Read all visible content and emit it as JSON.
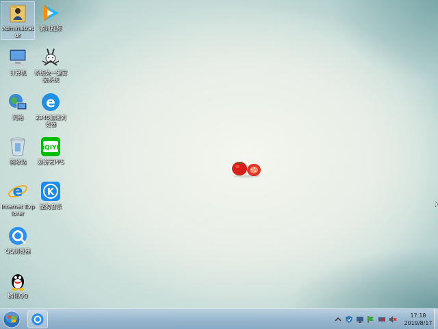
{
  "desktop_icons": [
    {
      "label": "Administrator",
      "icon": "user-folder-icon"
    },
    {
      "label": "腾讯视频",
      "icon": "tencent-video-icon"
    },
    {
      "label": "计算机",
      "icon": "computer-icon"
    },
    {
      "label": "系统免一键安装系统",
      "icon": "rabbit-installer-icon"
    },
    {
      "label": "网络",
      "icon": "network-icon"
    },
    {
      "label": "2345加速浏览器",
      "icon": "ie-blue-e-icon"
    },
    {
      "label": "回收站",
      "icon": "recycle-bin-icon"
    },
    {
      "label": "爱奇艺PPS",
      "icon": "iqiyi-icon"
    },
    {
      "label": "Internet Explorer",
      "icon": "internet-explorer-icon"
    },
    {
      "label": "酷狗音乐",
      "icon": "kugou-icon"
    },
    {
      "label": "QQ浏览器",
      "icon": "qq-browser-icon"
    },
    {
      "label": "腾讯QQ",
      "icon": "qq-penguin-icon"
    }
  ],
  "taskbar": {
    "clock_time": "17:18",
    "clock_date": "2019/8/17"
  },
  "colors": {
    "taskbar": "#9fbcd2",
    "iqiyi_green": "#00be06",
    "kugou_blue": "#1a8cf0"
  }
}
